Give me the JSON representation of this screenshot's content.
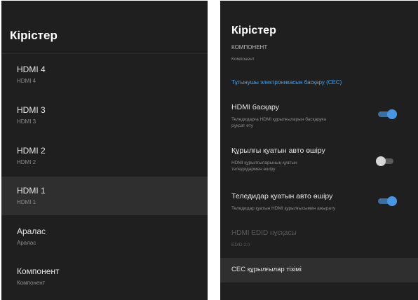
{
  "left": {
    "title": "Кірістер",
    "inputs": [
      {
        "label": "HDMI 4",
        "sub": "HDMI 4"
      },
      {
        "label": "HDMI 3",
        "sub": "HDMI 3"
      },
      {
        "label": "HDMI 2",
        "sub": "HDMI 2"
      },
      {
        "label": "HDMI 1",
        "sub": "HDMI 1"
      },
      {
        "label": "Аралас",
        "sub": "Аралас"
      },
      {
        "label": "Компонент",
        "sub": "Компонент"
      }
    ],
    "selected_index": 3
  },
  "right": {
    "title": "Кірістер",
    "partial_item": {
      "label": "КОМПОНЕНТ",
      "sub": "Компонент"
    },
    "section_header": "Тұтынушы электроникасын басқару (CEC)",
    "settings": [
      {
        "label": "HDMI басқару",
        "sub_lines": [
          "Теледидарға HDMI құрылғыларын басқаруға",
          "рұқсат ету"
        ],
        "enabled": true
      },
      {
        "label": "Құрылғы қуатын авто өшіру",
        "sub_lines": [
          "HDMI құрылғыларының қуатын",
          "теледидармен өшіру"
        ],
        "enabled": false
      },
      {
        "label": "Теледидар қуатын авто өшіру",
        "sub_lines": [
          "Теледидар қуатын HDMI құрылғысымен ажырату"
        ],
        "enabled": true
      }
    ],
    "edid": {
      "label": "HDMI EDID нұсқасы",
      "sub": "EDID 2.0"
    },
    "cec_devices_label": "CEC құрылғылар тізімі"
  },
  "colors": {
    "background": "#1f1f1f",
    "selected_row": "#2f2f2f",
    "accent": "#4a96e4",
    "section_header": "#4da3ee"
  }
}
